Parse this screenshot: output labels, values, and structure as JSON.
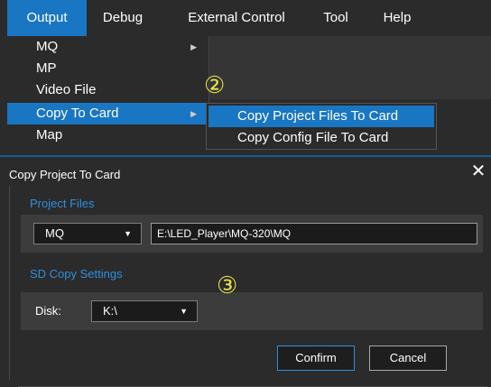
{
  "menubar": {
    "items": [
      {
        "label": "Output"
      },
      {
        "label": "Debug"
      },
      {
        "label": "External Control"
      },
      {
        "label": "Tool"
      },
      {
        "label": "Help"
      }
    ]
  },
  "output_menu": {
    "items": [
      {
        "label": "MQ"
      },
      {
        "label": "MP"
      },
      {
        "label": "Video File"
      },
      {
        "label": "Copy To Card"
      },
      {
        "label": "Map"
      }
    ]
  },
  "copy_to_card_submenu": {
    "items": [
      {
        "label": "Copy Project Files To Card"
      },
      {
        "label": "Copy Config File To Card"
      }
    ]
  },
  "step_markers": [
    "②",
    "③"
  ],
  "dialog": {
    "title": "Copy Project To Card",
    "close_symbol": "✕",
    "project_files": {
      "section_label": "Project Files",
      "type_value": "MQ",
      "path_value": "E:\\LED_Player\\MQ-320\\MQ"
    },
    "sd_copy": {
      "section_label": "SD Copy Settings",
      "disk_label": "Disk:",
      "disk_value": "K:\\"
    },
    "confirm_label": "Confirm",
    "cancel_label": "Cancel"
  },
  "colors": {
    "accent": "#1976c2",
    "section_label": "#2f8fe0",
    "step_marker": "#e9e34a",
    "background": "#2b2b2b"
  }
}
